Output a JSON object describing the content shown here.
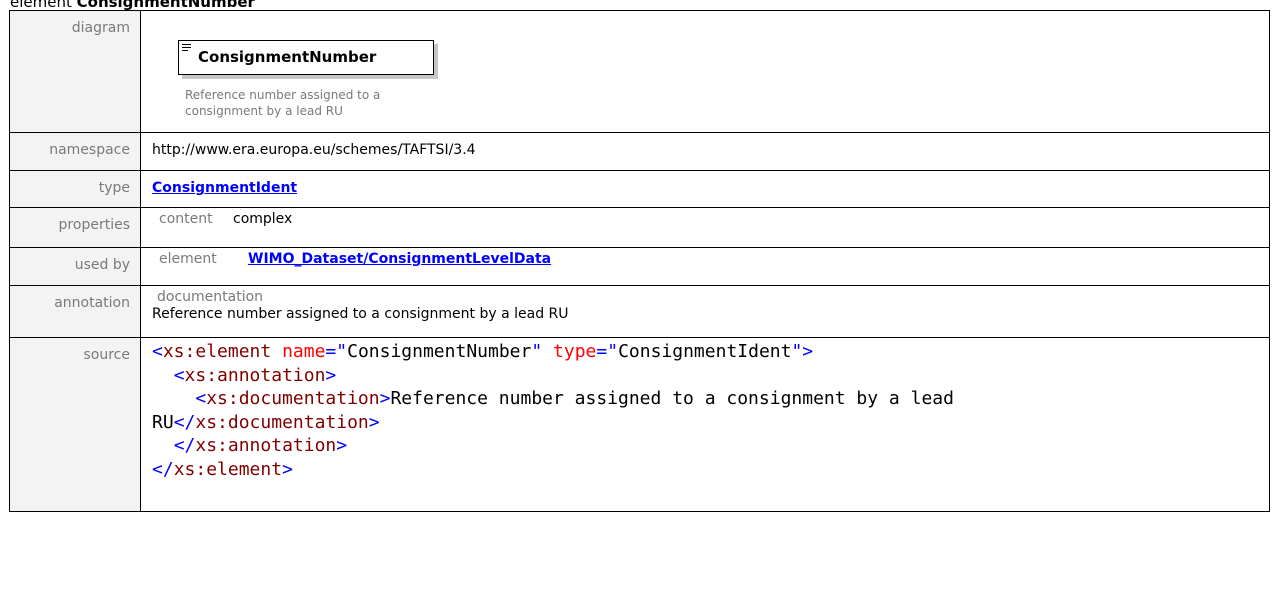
{
  "heading": {
    "prefix": "element ",
    "name": "ConsignmentNumber"
  },
  "rows": {
    "diagram": {
      "label": "diagram",
      "element_name": "ConsignmentNumber",
      "description": "Reference number assigned to a consignment by a lead RU"
    },
    "namespace": {
      "label": "namespace",
      "value": "http://www.era.europa.eu/schemes/TAFTSI/3.4"
    },
    "type": {
      "label": "type",
      "link": "ConsignmentIdent"
    },
    "properties": {
      "label": "properties",
      "key": "content",
      "value": "complex"
    },
    "used_by": {
      "label": "used by",
      "key": "element",
      "link": "WIMO_Dataset/ConsignmentLevelData"
    },
    "annotation": {
      "label": "annotation",
      "key": "documentation",
      "text": "Reference number assigned to a consignment by a lead RU"
    },
    "source": {
      "label": "source",
      "lines": {
        "l1_open": "<",
        "l1_tag": "xs:element",
        "l1_attr1": "name",
        "l1_eq1": "=\"",
        "l1_val1": "ConsignmentNumber",
        "l1_q1": "\"",
        "l1_attr2": "type",
        "l1_eq2": "=\"",
        "l1_val2": "ConsignmentIdent",
        "l1_close": "\">",
        "l2_open": "<",
        "l2_tag": "xs:annotation",
        "l2_close": ">",
        "l3_open": "<",
        "l3_tag": "xs:documentation",
        "l3_close": ">",
        "l3_text": "Reference number assigned to a consignment by a lead",
        "l4_text": "RU",
        "l4_open": "</",
        "l4_tag": "xs:documentation",
        "l4_close": ">",
        "l5_open": "</",
        "l5_tag": "xs:annotation",
        "l5_close": ">",
        "l6_open": "</",
        "l6_tag": "xs:element",
        "l6_close": ">"
      }
    }
  },
  "colors": {
    "label_bg": "#f3f3f3",
    "label_text": "#7a7a7a",
    "link": "#0000ff",
    "xml_tag": "#800000",
    "xml_attr": "#ff0000",
    "xml_punct": "#0000ff"
  }
}
